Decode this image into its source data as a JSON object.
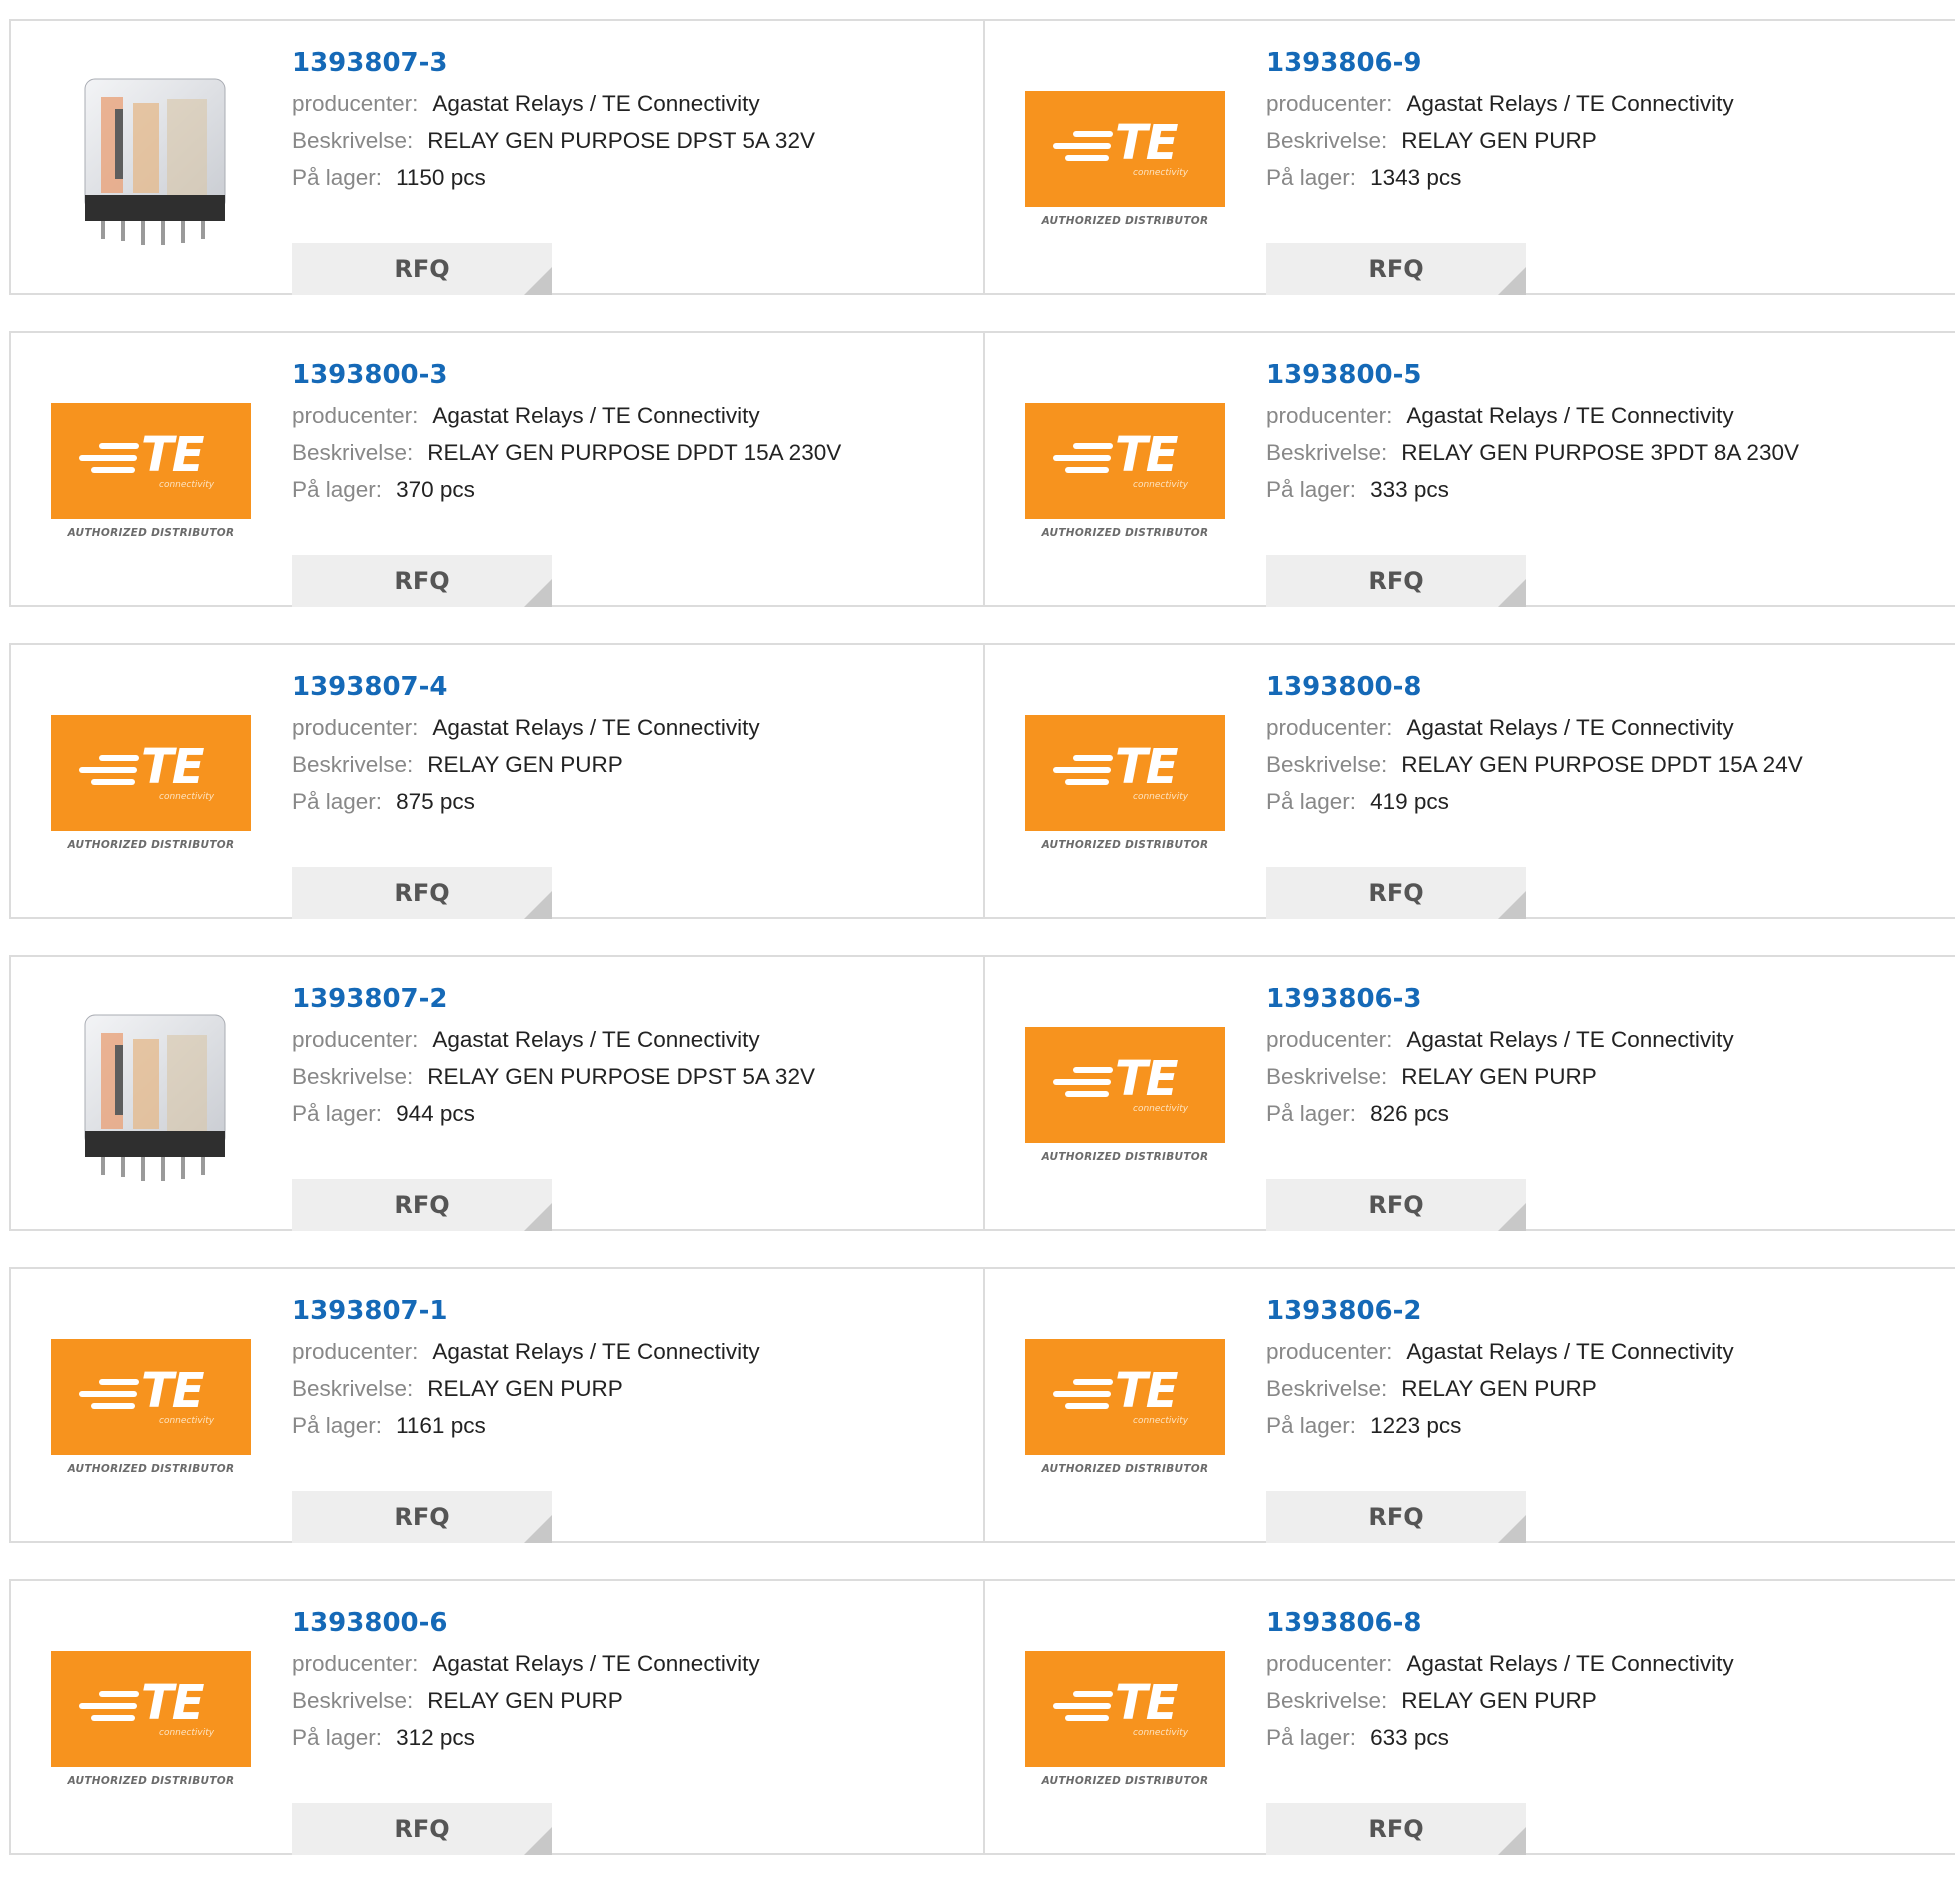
{
  "labels": {
    "manufacturer": "producenter:",
    "description": "Beskrivelse:",
    "stock": "På lager:",
    "rfq": "RFQ"
  },
  "logo": {
    "letters": "TE",
    "sub": "connectivity",
    "authorized": "AUTHORIZED DISTRIBUTOR",
    "brand_color": "#f7931e"
  },
  "colors": {
    "part_number": "#1569b7"
  },
  "products": [
    {
      "part": "1393807-3",
      "image": "relay-photo",
      "manufacturer": "Agastat Relays / TE Connectivity",
      "description": "RELAY GEN PURPOSE DPST 5A 32V",
      "stock": "1150 pcs"
    },
    {
      "part": "1393806-9",
      "image": "te-logo",
      "manufacturer": "Agastat Relays / TE Connectivity",
      "description": "RELAY GEN PURP",
      "stock": "1343 pcs"
    },
    {
      "part": "1393800-3",
      "image": "te-logo",
      "manufacturer": "Agastat Relays / TE Connectivity",
      "description": "RELAY GEN PURPOSE DPDT 15A 230V",
      "stock": "370 pcs"
    },
    {
      "part": "1393800-5",
      "image": "te-logo",
      "manufacturer": "Agastat Relays / TE Connectivity",
      "description": "RELAY GEN PURPOSE 3PDT 8A 230V",
      "stock": "333 pcs"
    },
    {
      "part": "1393807-4",
      "image": "te-logo",
      "manufacturer": "Agastat Relays / TE Connectivity",
      "description": "RELAY GEN PURP",
      "stock": "875 pcs"
    },
    {
      "part": "1393800-8",
      "image": "te-logo",
      "manufacturer": "Agastat Relays / TE Connectivity",
      "description": "RELAY GEN PURPOSE DPDT 15A 24V",
      "stock": "419 pcs"
    },
    {
      "part": "1393807-2",
      "image": "relay-photo",
      "manufacturer": "Agastat Relays / TE Connectivity",
      "description": "RELAY GEN PURPOSE DPST 5A 32V",
      "stock": "944 pcs"
    },
    {
      "part": "1393806-3",
      "image": "te-logo",
      "manufacturer": "Agastat Relays / TE Connectivity",
      "description": "RELAY GEN PURP",
      "stock": "826 pcs"
    },
    {
      "part": "1393807-1",
      "image": "te-logo",
      "manufacturer": "Agastat Relays / TE Connectivity",
      "description": "RELAY GEN PURP",
      "stock": "1161 pcs"
    },
    {
      "part": "1393806-2",
      "image": "te-logo",
      "manufacturer": "Agastat Relays / TE Connectivity",
      "description": "RELAY GEN PURP",
      "stock": "1223 pcs"
    },
    {
      "part": "1393800-6",
      "image": "te-logo",
      "manufacturer": "Agastat Relays / TE Connectivity",
      "description": "RELAY GEN PURP",
      "stock": "312 pcs"
    },
    {
      "part": "1393806-8",
      "image": "te-logo",
      "manufacturer": "Agastat Relays / TE Connectivity",
      "description": "RELAY GEN PURP",
      "stock": "633 pcs"
    }
  ]
}
